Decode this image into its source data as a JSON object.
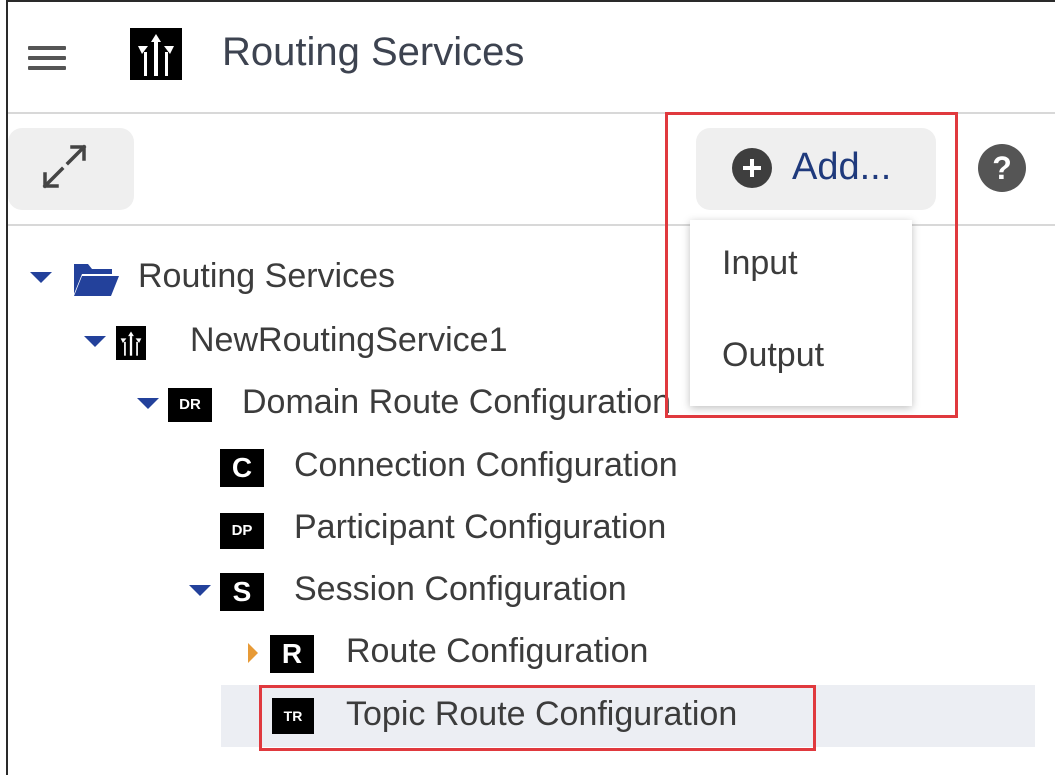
{
  "header": {
    "menu_icon": "hamburger-menu-icon",
    "logo_icon": "routing-service-icon",
    "title": "Routing Services"
  },
  "toolbar": {
    "expand_icon": "expand-arrows-icon",
    "add_label": "Add...",
    "add_icon": "plus-circle-icon",
    "help_icon": "help-circle-icon",
    "help_glyph": "?"
  },
  "add_menu": {
    "items": [
      {
        "label": "Input"
      },
      {
        "label": "Output"
      }
    ]
  },
  "tree": {
    "root": {
      "label": "Routing Services",
      "icon": "folder-open-icon"
    },
    "service": {
      "label": "NewRoutingService1",
      "icon": "routing-service-icon"
    },
    "domain_route": {
      "label": "Domain Route Configuration",
      "badge": "DR"
    },
    "connection": {
      "label": "Connection Configuration",
      "badge": "C"
    },
    "participant": {
      "label": "Participant Configuration",
      "badge": "DP"
    },
    "session": {
      "label": "Session Configuration",
      "badge": "S"
    },
    "route": {
      "label": "Route Configuration",
      "badge": "R"
    },
    "topic_route": {
      "label": "Topic Route Configuration",
      "badge": "TR"
    }
  },
  "colors": {
    "accent_blue": "#1f3a7c",
    "expand_arrow": "#23419b",
    "collapsed_arrow": "#e79a36",
    "highlight_red": "#e0393e",
    "selected_row_bg": "#eceef3"
  }
}
